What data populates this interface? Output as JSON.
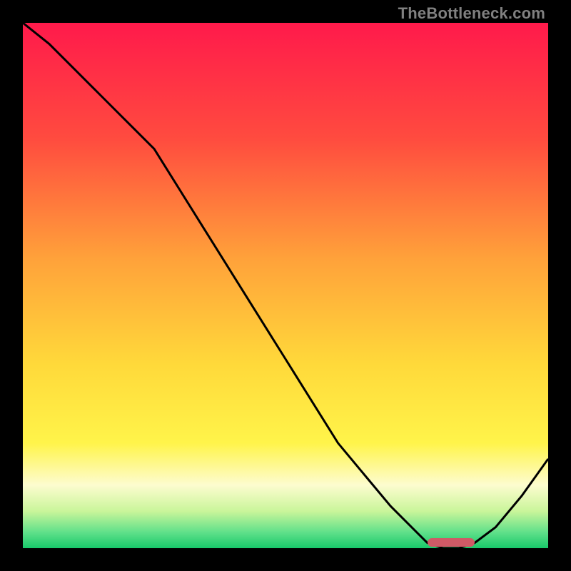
{
  "watermark": "TheBottleneck.com",
  "chart_data": {
    "type": "line",
    "title": "",
    "xlabel": "",
    "ylabel": "",
    "xlim": [
      0,
      100
    ],
    "ylim": [
      0,
      100
    ],
    "x": [
      0,
      5,
      10,
      15,
      20,
      25,
      30,
      35,
      40,
      45,
      50,
      55,
      60,
      65,
      70,
      75,
      77,
      80,
      83,
      86,
      90,
      95,
      100
    ],
    "values": [
      100,
      96,
      91,
      86,
      81,
      76,
      68,
      60,
      52,
      44,
      36,
      28,
      20,
      14,
      8,
      3,
      1,
      0,
      0,
      1,
      4,
      10,
      17
    ],
    "marker": {
      "x_start": 77,
      "x_end": 86,
      "y": 0
    },
    "gradient_stops": [
      {
        "pct": 0,
        "color": "#ff1a4b"
      },
      {
        "pct": 22,
        "color": "#ff4b3f"
      },
      {
        "pct": 45,
        "color": "#ffa23a"
      },
      {
        "pct": 65,
        "color": "#ffd93a"
      },
      {
        "pct": 80,
        "color": "#fff44a"
      },
      {
        "pct": 88,
        "color": "#fdfccf"
      },
      {
        "pct": 93,
        "color": "#c9f59a"
      },
      {
        "pct": 97,
        "color": "#5fe08a"
      },
      {
        "pct": 100,
        "color": "#18c86a"
      }
    ]
  }
}
